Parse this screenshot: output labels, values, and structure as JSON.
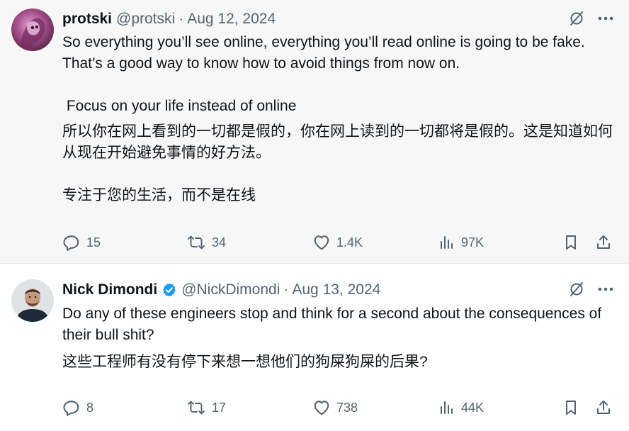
{
  "posts": [
    {
      "name": "protski",
      "handle": "@protski",
      "separator": "·",
      "date": "Aug 12, 2024",
      "verified": false,
      "paragraphs": [
        "So everything you’ll see online, everything you’ll read online is going to be fake. That’s a good way to know how to avoid things from now on.",
        " Focus on your life instead of online",
        "所以你在网上看到的一切都是假的，你在网上读到的一切都将是假的。这是知道如何从现在开始避免事情的好方法。",
        "专注于您的生活，而不是在线"
      ],
      "stats": {
        "replies": "15",
        "reposts": "34",
        "likes": "1.4K",
        "views": "97K"
      }
    },
    {
      "name": "Nick Dimondi",
      "handle": "@NickDimondi",
      "separator": "·",
      "date": "Aug 13, 2024",
      "verified": true,
      "paragraphs": [
        "Do any of these engineers stop and think for a second about the consequences of their bull shit?",
        "这些工程师有没有停下来想一想他们的狗屎狗屎的后果?"
      ],
      "stats": {
        "replies": "8",
        "reposts": "17",
        "likes": "738",
        "views": "44K"
      }
    }
  ],
  "colors": {
    "text": "#0f1419",
    "muted": "#536471",
    "verified": "#1d9bf0",
    "post1_bg": "#f7f7f7",
    "post2_bg": "#ffffff"
  },
  "icons": [
    "grok-icon",
    "more-icon",
    "reply-icon",
    "repost-icon",
    "like-icon",
    "views-icon",
    "bookmark-icon",
    "share-icon",
    "verified-badge-icon"
  ]
}
